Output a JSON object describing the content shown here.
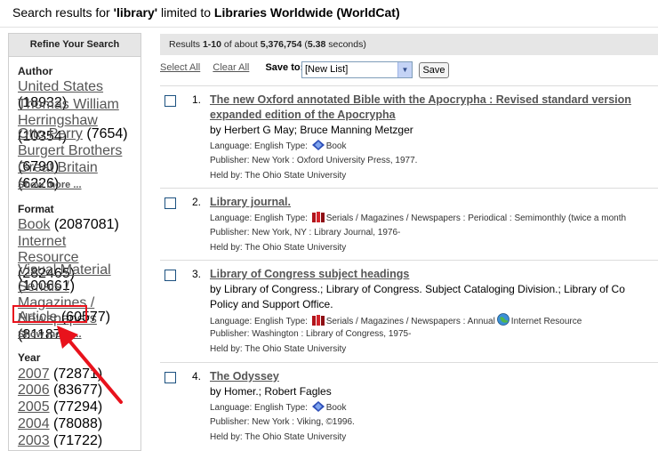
{
  "header": {
    "prefix": "Search results for ",
    "query": "'library'",
    "mid": " limited to ",
    "scope": "Libraries Worldwide (WorldCat)"
  },
  "sidebar": {
    "title": "Refine Your Search",
    "author": {
      "heading": "Author",
      "items": [
        {
          "label": "United States",
          "count": "(18932)"
        },
        {
          "label": "Thomas William Herringshaw",
          "count": "(10354)"
        },
        {
          "label": "Otto Perry",
          "count": "(7654)"
        },
        {
          "label": "Burgert Brothers",
          "count": "(6790)"
        },
        {
          "label": "Great Britain",
          "count": "(6226)"
        }
      ],
      "more": "Show more ..."
    },
    "format": {
      "heading": "Format",
      "items": [
        {
          "label": "Book",
          "count": "(2087081)"
        },
        {
          "label": "Internet Resource",
          "count": "(282465)"
        },
        {
          "label": "Visual Material",
          "count": "(100661)"
        },
        {
          "label": "Serials / Magazines / Newspapers",
          "count": "(81187)"
        },
        {
          "label": "Article",
          "count": "(60577)"
        }
      ],
      "more": "Show more ..."
    },
    "year": {
      "heading": "Year",
      "items": [
        {
          "label": "2007",
          "count": "(72871)"
        },
        {
          "label": "2006",
          "count": "(83677)"
        },
        {
          "label": "2005",
          "count": "(77294)"
        },
        {
          "label": "2004",
          "count": "(78088)"
        },
        {
          "label": "2003",
          "count": "(71722)"
        }
      ]
    }
  },
  "results_bar": {
    "a": "Results ",
    "range": "1-10",
    "b": " of about ",
    "total": "5,376,754",
    "c": " (",
    "time": "5.38",
    "d": " seconds)"
  },
  "tools": {
    "select_all": "Select All",
    "clear_all": "Clear All",
    "save_to": "Save to:",
    "list_value": "[New List]",
    "save": "Save"
  },
  "records": [
    {
      "num": "1.",
      "title1": "The new Oxford annotated Bible with the Apocrypha : Revised standard version",
      "title2": "expanded edition of the Apocrypha",
      "by": "by Herbert G May; Bruce Manning Metzger",
      "lang": "Language: English  Type: ",
      "type": "Book",
      "publisher": "Publisher: New York : Oxford University Press, 1977.",
      "held": "Held by: The Ohio State University"
    },
    {
      "num": "2.",
      "title1": "Library journal.",
      "lang": "Language: English  Type: ",
      "type": "Serials / Magazines / Newspapers : Periodical : Semimonthly (twice a month",
      "publisher": "Publisher: New York, NY : Library Journal, 1976-",
      "held": "Held by: The Ohio State University"
    },
    {
      "num": "3.",
      "title1": "Library of Congress subject headings",
      "by": "by Library of Congress.; Library of Congress. Subject Cataloging Division.; Library of Co",
      "by2": "Policy and Support Office.",
      "lang": "Language: English  Type: ",
      "type": "Serials / Magazines / Newspapers : Annual",
      "type2": "Internet Resource",
      "publisher": "Publisher: Washington : Library of Congress, 1975-",
      "held": "Held by: The Ohio State University"
    },
    {
      "num": "4.",
      "title1": "The Odyssey",
      "by": "by Homer.; Robert Fagles",
      "lang": "Language: English  Type: ",
      "type": "Book",
      "publisher": "Publisher: New York : Viking, ©1996.",
      "held": "Held by: The Ohio State University"
    }
  ],
  "colors": {
    "annotation": "#e8121c",
    "link_gray": "#555555",
    "header_bar": "#e6e6e6"
  }
}
